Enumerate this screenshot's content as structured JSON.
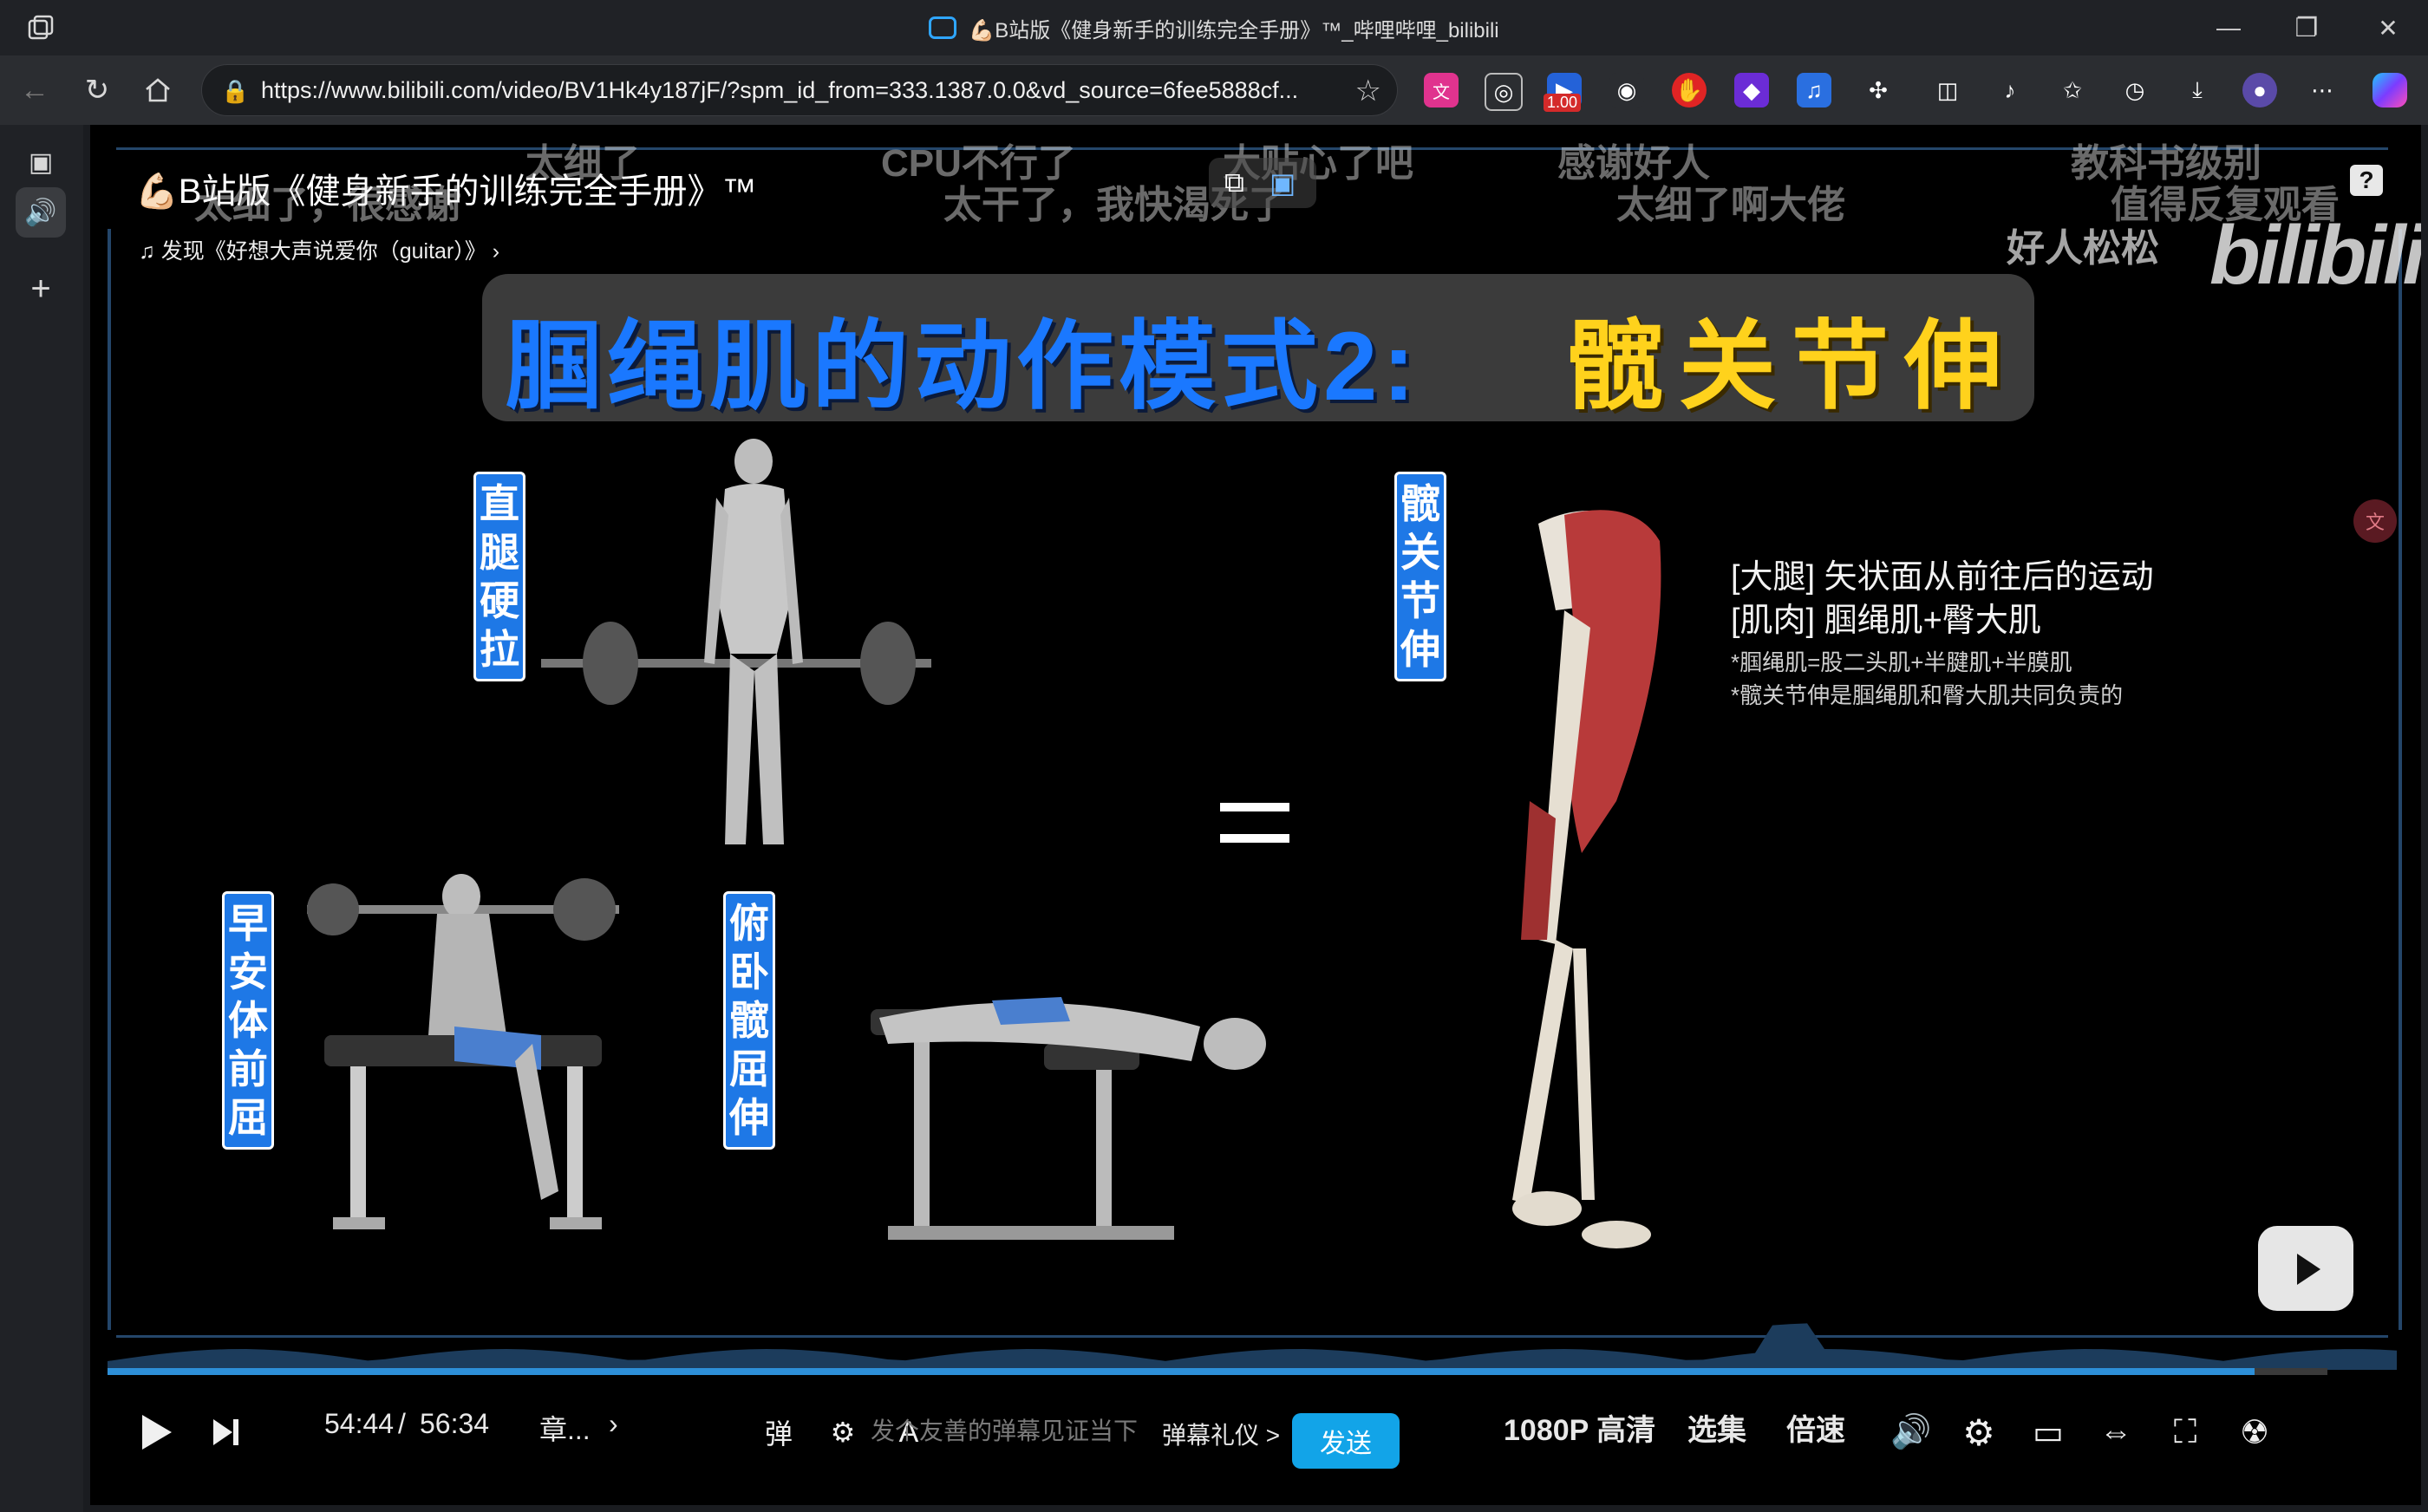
{
  "window": {
    "title": "💪🏻B站版《健身新手的训练完全手册》™_哔哩哔哩_bilibili",
    "minimize": "—",
    "restore": "❐",
    "close": "✕"
  },
  "toolbar": {
    "url": "https://www.bilibili.com/video/BV1Hk4y187jF/?spm_id_from=333.1387.0.0&vd_source=6fee5888cf...",
    "ext_badge": "1.00"
  },
  "video": {
    "title": "💪🏻B站版《健身新手的训练完全手册》™",
    "music": "发现《好想大声说爱你（guitar）》",
    "logo": "bilibili",
    "help": "?",
    "danmaku": [
      "太细了",
      "CPU不行了",
      "大贴心了吧",
      "感谢好人",
      "教科书级别",
      "太干了，我快渴死了",
      "太细了啊大佬",
      "值得反复观看",
      "好人松松",
      "太细了，很感谢"
    ],
    "banner_blue": "腘绳肌的动作模式2:",
    "banner_yellow": "髋关节伸",
    "labels": {
      "straight_leg_deadlift": "直腿硬拉",
      "good_morning": "早安体前屈",
      "prone_hip_extension": "俯卧髋屈伸",
      "hip_extension": "髋关节伸"
    },
    "equals": "=",
    "info": {
      "line1": "[大腿] 矢状面从前往后的运动",
      "line2": "[肌肉] 腘绳肌+臀大肌",
      "note1": "*腘绳肌=股二头肌+半腱肌+半膜肌",
      "note2": "*髋关节伸是腘绳肌和臀大肌共同负责的"
    }
  },
  "controls": {
    "time_current": "54:44",
    "time_sep": "/",
    "time_total": "56:34",
    "progress": 0.967,
    "chapter": "章...",
    "danmaku_placeholder": "发个友善的弹幕见证当下",
    "danmaku_etiquette": "弹幕礼仪 >",
    "send": "发送",
    "quality": "1080P 高清",
    "episodes": "选集",
    "speed": "倍速"
  }
}
